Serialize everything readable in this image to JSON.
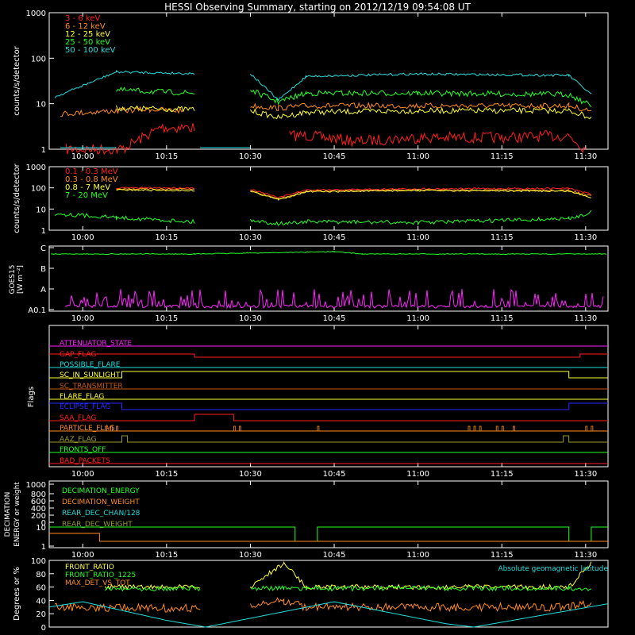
{
  "title": "HESSI Observing Summary, starting on 2012/12/19 09:54:08 UT",
  "time_ticks": [
    "10:00",
    "10:15",
    "10:30",
    "10:45",
    "11:00",
    "11:15",
    "11:30"
  ],
  "colors": {
    "red": "#ff2020",
    "orange": "#ff8c1a",
    "yellow": "#ffff33",
    "green": "#22ff22",
    "cyan": "#22dddd",
    "magenta": "#ff22ff",
    "blue": "#2a2aff",
    "white": "#ffffff",
    "olive": "#9a9a2a",
    "darkorange": "#c85a14"
  },
  "panels": {
    "hxr": {
      "ylabel": "counts/s/detector",
      "yticks": [
        "1",
        "10",
        "100",
        "1000"
      ],
      "legend": [
        "3 - 6 keV",
        "6 - 12 keV",
        "12 - 25 keV",
        "25 - 50 keV",
        "50 - 100 keV"
      ]
    },
    "gamma": {
      "ylabel": "counts/s/detector",
      "yticks": [
        "1",
        "10",
        "100",
        "1000"
      ],
      "legend": [
        "0.1 - 0.3 MeV",
        "0.3 - 0.8 MeV",
        "0.8 - 7 MeV",
        "7 - 20 MeV"
      ]
    },
    "goes": {
      "ylabel": "GOES15",
      "yunit": "[W m⁻²]",
      "yticks": [
        "A0.1",
        "A",
        "B",
        "C"
      ]
    },
    "flags": {
      "ylabel": "Flags",
      "items": [
        "ATTENUATOR_STATE",
        "GAP_FLAG",
        "POSSIBLE_FLARE",
        "SC_IN_SUNLIGHT",
        "SC_TRANSMITTER",
        "FLARE_FLAG",
        "ECLIPSE_FLAG",
        "SAA_FLAG",
        "PARTICLE_FLAG",
        "AAZ_FLAG",
        "FRONTS_OFF",
        "BAD_PACKETS"
      ]
    },
    "decimation": {
      "ylabel1": "DECIMATION",
      "ylabel2": "ENERGY or weight",
      "yticks": [
        "0",
        "200",
        "400",
        "600",
        "800",
        "1000",
        "1",
        "10"
      ],
      "legend": [
        "DECIMATION_ENERGY",
        "DECIMATION_WEIGHT",
        "REAR_DEC_CHAN/128",
        "REAR_DEC_WEIGHT"
      ]
    },
    "ratio": {
      "ylabel": "Degrees or %",
      "yticks": [
        "0",
        "20",
        "40",
        "60",
        "80",
        "100"
      ],
      "legend": [
        "FRONT_RATIO",
        "FRONT_RATIO_1225",
        "MAX_DET_VS_TOT"
      ],
      "annotation": "Absolute geomagnetic latitude"
    }
  },
  "chart_data": [
    {
      "type": "line",
      "ylabel": "counts/s/detector",
      "yscale": "log",
      "ylim": [
        1,
        1000
      ],
      "xlim": [
        "09:54",
        "11:34"
      ],
      "series": [
        {
          "name": "3 - 6 keV",
          "segments": [
            [
              [
                "09:57",
                1
              ],
              [
                "10:07",
                1
              ],
              [
                "10:14",
                3
              ],
              [
                "10:20",
                3
              ]
            ],
            [
              [
                "10:37",
                2
              ],
              [
                "10:40",
                2
              ],
              [
                "10:49",
                1.5
              ],
              [
                "11:00",
                1.8
              ],
              [
                "11:15",
                1.8
              ],
              [
                "11:27",
                2
              ],
              [
                "11:30",
                1
              ]
            ]
          ]
        },
        {
          "name": "6 - 12 keV",
          "segments": [
            [
              [
                "09:56",
                6
              ],
              [
                "10:06",
                7
              ],
              [
                "10:12",
                7.5
              ],
              [
                "10:18",
                7
              ]
            ],
            [
              [
                "10:30",
                9
              ],
              [
                "10:35",
                8
              ],
              [
                "10:40",
                9
              ],
              [
                "11:00",
                9
              ],
              [
                "11:20",
                9
              ],
              [
                "11:27",
                9
              ],
              [
                "11:31",
                7
              ]
            ]
          ]
        },
        {
          "name": "12 - 25 keV",
          "segments": [
            [
              [
                "10:06",
                8
              ],
              [
                "10:20",
                7.5
              ]
            ],
            [
              [
                "10:30",
                7
              ],
              [
                "10:35",
                5
              ],
              [
                "10:40",
                6.5
              ],
              [
                "11:00",
                7
              ],
              [
                "11:27",
                7
              ],
              [
                "11:31",
                5
              ]
            ]
          ]
        },
        {
          "name": "25 - 50 keV",
          "segments": [
            [
              [
                "10:06",
                20
              ],
              [
                "10:20",
                17
              ]
            ],
            [
              [
                "10:30",
                20
              ],
              [
                "10:35",
                11
              ],
              [
                "10:40",
                17
              ],
              [
                "11:00",
                17
              ],
              [
                "11:27",
                16
              ],
              [
                "11:31",
                9
              ]
            ]
          ]
        },
        {
          "name": "50 - 100 keV",
          "segments": [
            [
              [
                "09:55",
                14
              ],
              [
                "10:06",
                50
              ],
              [
                "10:20",
                46
              ]
            ],
            [
              [
                "10:30",
                46
              ],
              [
                "10:35",
                12
              ],
              [
                "10:40",
                40
              ],
              [
                "11:00",
                45
              ],
              [
                "11:27",
                42
              ],
              [
                "11:31",
                16
              ]
            ]
          ]
        }
      ]
    },
    {
      "type": "line",
      "ylabel": "counts/s/detector",
      "yscale": "log",
      "ylim": [
        1,
        1000
      ],
      "xlim": [
        "09:54",
        "11:34"
      ],
      "series": [
        {
          "name": "0.1 - 0.3 MeV",
          "segments": [
            [
              [
                "10:06",
                100
              ],
              [
                "10:20",
                100
              ]
            ],
            [
              [
                "10:30",
                85
              ],
              [
                "10:35",
                35
              ],
              [
                "10:40",
                80
              ],
              [
                "11:00",
                90
              ],
              [
                "11:27",
                95
              ],
              [
                "11:31",
                50
              ]
            ]
          ]
        },
        {
          "name": "0.3 - 0.8 MeV",
          "segments": [
            [
              [
                "10:06",
                90
              ],
              [
                "10:20",
                85
              ]
            ],
            [
              [
                "10:30",
                75
              ],
              [
                "10:35",
                30
              ],
              [
                "10:40",
                70
              ],
              [
                "11:00",
                80
              ],
              [
                "11:27",
                75
              ],
              [
                "11:31",
                40
              ]
            ]
          ]
        },
        {
          "name": "0.8 - 7 MeV",
          "segments": [
            [
              [
                "10:06",
                80
              ],
              [
                "10:20",
                75
              ]
            ],
            [
              [
                "10:30",
                70
              ],
              [
                "10:35",
                28
              ],
              [
                "10:40",
                65
              ],
              [
                "11:00",
                75
              ],
              [
                "11:27",
                70
              ],
              [
                "11:31",
                35
              ]
            ]
          ]
        },
        {
          "name": "7 - 20 MeV",
          "segments": [
            [
              [
                "09:55",
                6
              ],
              [
                "10:06",
                4
              ],
              [
                "10:20",
                2.5
              ]
            ],
            [
              [
                "10:30",
                3
              ],
              [
                "10:35",
                2
              ],
              [
                "10:40",
                2.5
              ],
              [
                "11:00",
                2.3
              ],
              [
                "11:27",
                3.5
              ],
              [
                "11:31",
                7
              ]
            ]
          ]
        }
      ]
    },
    {
      "type": "line",
      "ylabel": "GOES15",
      "ylim": [
        "A0.1",
        "C"
      ],
      "xlim": [
        "09:54",
        "11:34"
      ],
      "series": [
        {
          "name": "green",
          "segments": [
            [
              [
                "09:54",
                "B-C"
              ],
              [
                "10:20",
                "B-C"
              ],
              [
                "10:45",
                "C"
              ],
              [
                "11:34",
                "B-C"
              ]
            ]
          ]
        },
        {
          "name": "magenta",
          "segments": [
            [
              [
                "09:54",
                "A0.1"
              ],
              [
                "11:34",
                "A0.1"
              ]
            ]
          ]
        }
      ]
    },
    {
      "type": "line",
      "ylabel": "DECIMATION ENERGY or weight",
      "xlim": [
        "09:54",
        "11:34"
      ],
      "series": [
        {
          "name": "DECIMATION_ENERGY",
          "segments": [
            [
              [
                "09:54",
                10
              ],
              [
                "10:38",
                10
              ],
              [
                "10:42",
                8
              ],
              [
                "11:27",
                8
              ],
              [
                "11:34",
                10
              ]
            ]
          ]
        },
        {
          "name": "DECIMATION_WEIGHT",
          "segments": [
            [
              [
                "09:54",
                3
              ],
              [
                "11:34",
                3
              ]
            ]
          ]
        }
      ]
    },
    {
      "type": "line",
      "ylabel": "Degrees or %",
      "ylim": [
        0,
        100
      ],
      "xlim": [
        "09:54",
        "11:34"
      ],
      "series": [
        {
          "name": "FRONT_RATIO",
          "segments": [
            [
              [
                "10:04",
                60
              ],
              [
                "10:21",
                60
              ]
            ],
            [
              [
                "10:30",
                60
              ],
              [
                "10:36",
                96
              ],
              [
                "10:40",
                60
              ],
              [
                "11:27",
                60
              ],
              [
                "11:31",
                96
              ]
            ]
          ]
        },
        {
          "name": "FRONT_RATIO_1225",
          "segments": [
            [
              [
                "10:04",
                58
              ],
              [
                "10:21",
                58
              ]
            ],
            [
              [
                "10:30",
                58
              ],
              [
                "10:36",
                58
              ],
              [
                "10:40",
                58
              ],
              [
                "11:27",
                58
              ],
              [
                "11:31",
                58
              ]
            ]
          ]
        },
        {
          "name": "MAX_DET_VS_TOT",
          "segments": [
            [
              [
                "09:55",
                30
              ],
              [
                "10:21",
                28
              ]
            ],
            [
              [
                "10:30",
                30
              ],
              [
                "10:36",
                40
              ],
              [
                "10:40",
                30
              ],
              [
                "11:27",
                30
              ],
              [
                "11:31",
                35
              ]
            ]
          ]
        },
        {
          "name": "Absolute geomagnetic latitude",
          "segments": [
            [
              [
                "09:54",
                30
              ],
              [
                "10:00",
                38
              ],
              [
                "10:15",
                10
              ],
              [
                "10:22",
                0
              ],
              [
                "10:45",
                38
              ],
              [
                "11:05",
                5
              ],
              [
                "11:10",
                0
              ],
              [
                "11:34",
                35
              ]
            ]
          ]
        }
      ]
    }
  ]
}
